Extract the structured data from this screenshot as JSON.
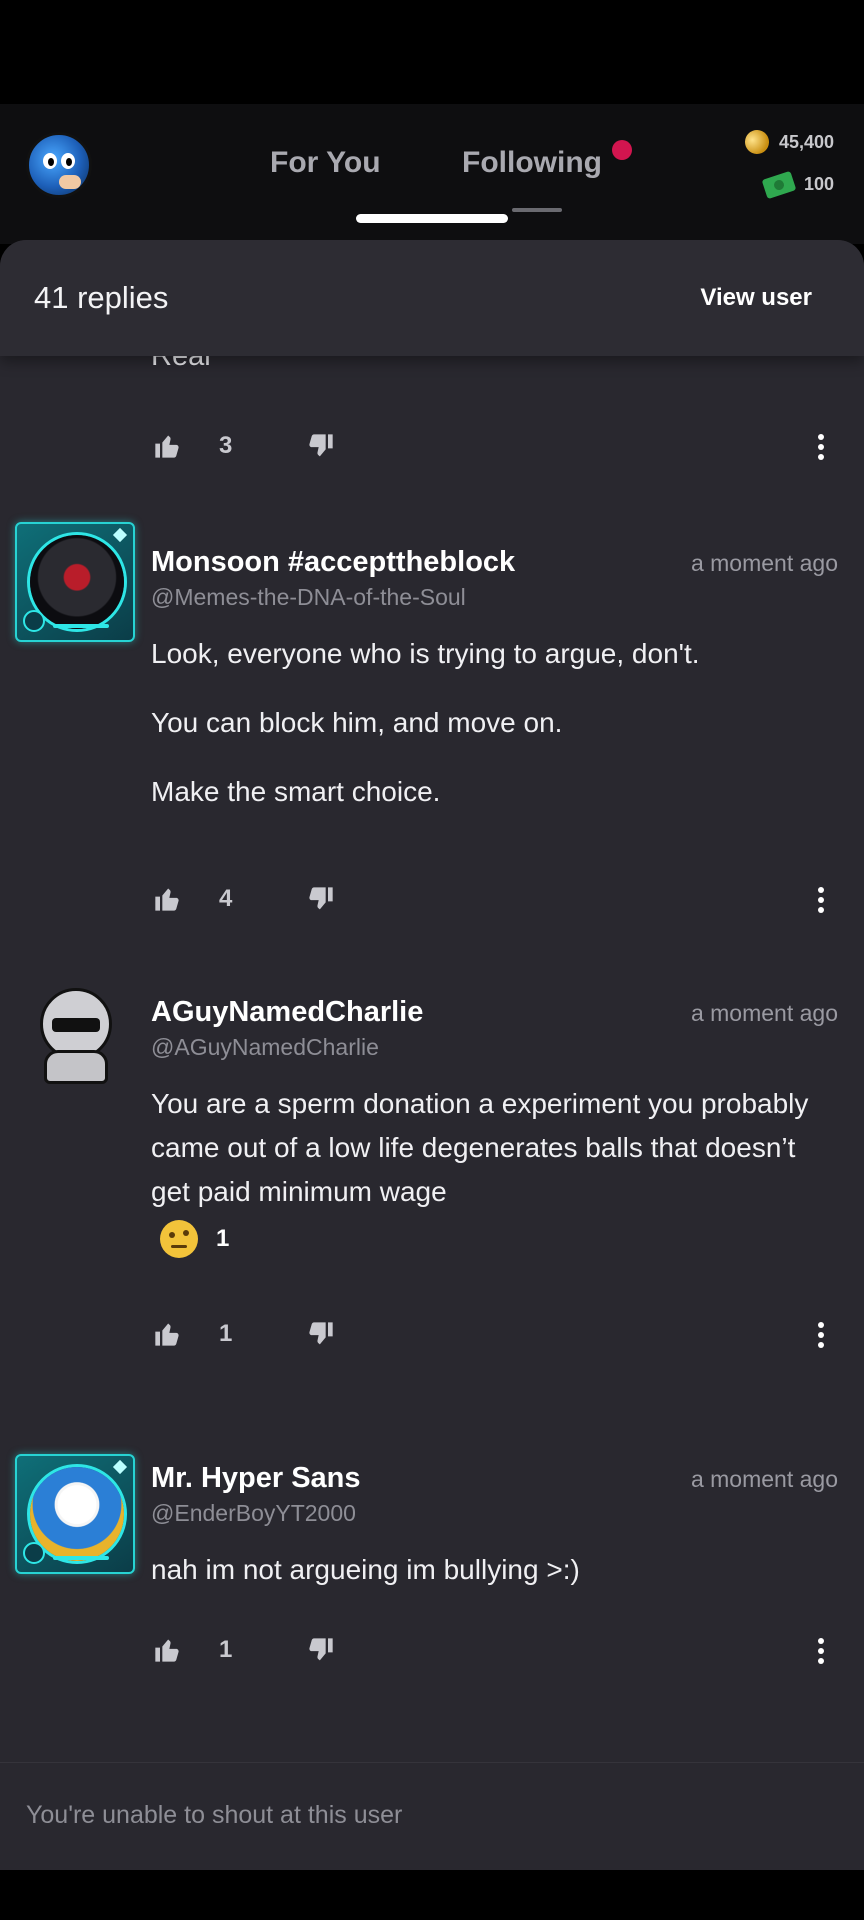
{
  "header": {
    "tabs": [
      {
        "label": "For You"
      },
      {
        "label": "Following"
      }
    ],
    "gold_balance": "45,400",
    "cash_balance": "100",
    "accent_color": "#d2154f"
  },
  "sheet": {
    "replies_label": "41 replies",
    "view_user_label": "View user"
  },
  "partial_comment": {
    "text": "Real",
    "likes": "3"
  },
  "comments": [
    {
      "username": "Monsoon #accepttheblock",
      "handle": "@Memes-the-DNA-of-the-Soul",
      "time": "a moment ago",
      "paragraphs": [
        "Look, everyone who is trying to argue, don't.",
        "You can block him, and move on.",
        "Make the smart choice."
      ],
      "likes": "4"
    },
    {
      "username": "AGuyNamedCharlie",
      "handle": "@AGuyNamedCharlie",
      "time": "a moment ago",
      "paragraphs": [
        "You are a sperm donation a experiment you probably came out of a low life degenerates balls that doesn’t get paid minimum wage"
      ],
      "reaction_count": "1",
      "likes": "1"
    },
    {
      "username": "Mr. Hyper Sans",
      "handle": "@EnderBoyYT2000",
      "time": "a moment ago",
      "paragraphs": [
        "nah im not argueing im bullying >:)"
      ],
      "likes": "1"
    }
  ],
  "composer": {
    "placeholder": "You're unable to shout at this user"
  },
  "icons": [
    "thumbs-up-icon",
    "thumbs-down-icon",
    "more-vertical-icon",
    "coin-icon",
    "cash-icon"
  ]
}
